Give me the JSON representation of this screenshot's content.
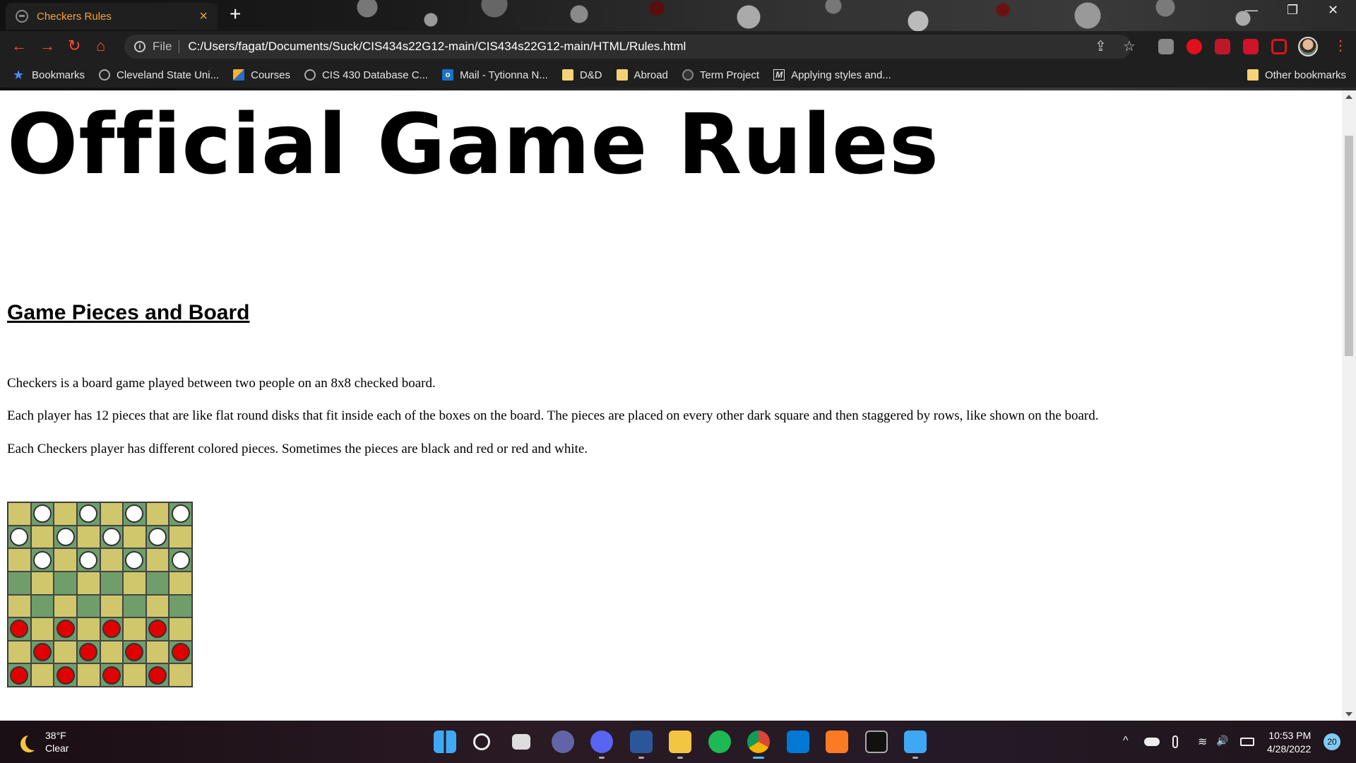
{
  "browser": {
    "tab": {
      "title": "Checkers Rules",
      "close": "×"
    },
    "new_tab": "+",
    "window_controls": {
      "minimize": "—",
      "restore": "❐",
      "close": "✕"
    },
    "nav": {
      "back": "←",
      "forward": "→",
      "reload": "↻",
      "home": "⌂"
    },
    "address": {
      "scheme": "File",
      "url": "C:/Users/fagat/Documents/Suck/CIS434s22G12-main/CIS434s22G12-main/HTML/Rules.html"
    },
    "omnibox_icons": {
      "share": "⇪",
      "bookmark": "☆"
    },
    "menu": "⋮",
    "accent_color": "#f6a33b",
    "bookmarks": [
      {
        "icon": "star-icon",
        "label": "Bookmarks"
      },
      {
        "icon": "globe-icon",
        "label": "Cleveland State Uni..."
      },
      {
        "icon": "pencil-icon",
        "label": "Courses"
      },
      {
        "icon": "globe-icon",
        "label": "CIS 430 Database C..."
      },
      {
        "icon": "outlook-icon",
        "label": "Mail - Tytionna N..."
      },
      {
        "icon": "folder-icon",
        "label": "D&D"
      },
      {
        "icon": "folder-icon",
        "label": "Abroad"
      },
      {
        "icon": "github-icon",
        "label": "Term Project"
      },
      {
        "icon": "medium-icon",
        "label": "Applying styles and..."
      }
    ],
    "other_bookmarks": "Other bookmarks"
  },
  "page": {
    "title": "Official Game Rules",
    "section_title": "Game Pieces and Board",
    "paragraphs": [
      "Checkers is a board game played between two people on an 8x8 checked board.",
      "Each player has 12 pieces that are like flat round disks that fit inside each of the boxes on the board. The pieces are placed on every other dark square and then staggered by rows, like shown on the board.",
      "Each Checkers player has different colored pieces. Sometimes the pieces are black and red or red and white."
    ],
    "board": {
      "size": 8,
      "light_color": "#d0c66c",
      "dark_color": "#6f9e6b",
      "rows": [
        "-W-W-W-W",
        "W-W-W-W-",
        "-W-W-W-W",
        "--------",
        "--------",
        "R-R-R-R-",
        "-R-R-R-R",
        "R-R-R-R-"
      ]
    }
  },
  "taskbar": {
    "weather": {
      "temp": "38°F",
      "condition": "Clear"
    },
    "clock": {
      "time": "10:53 PM",
      "date": "4/28/2022"
    },
    "notifications": "20",
    "apps": [
      "start-icon",
      "search-icon",
      "task-view-icon",
      "chat-icon",
      "discord-icon",
      "word-icon",
      "file-explorer-icon",
      "spotify-icon",
      "chrome-icon",
      "vscode-icon",
      "xampp-icon",
      "terminal-icon",
      "notepad-icon"
    ],
    "tray": {
      "chevron": "^",
      "wifi": "≋",
      "volume": "🔊"
    }
  }
}
